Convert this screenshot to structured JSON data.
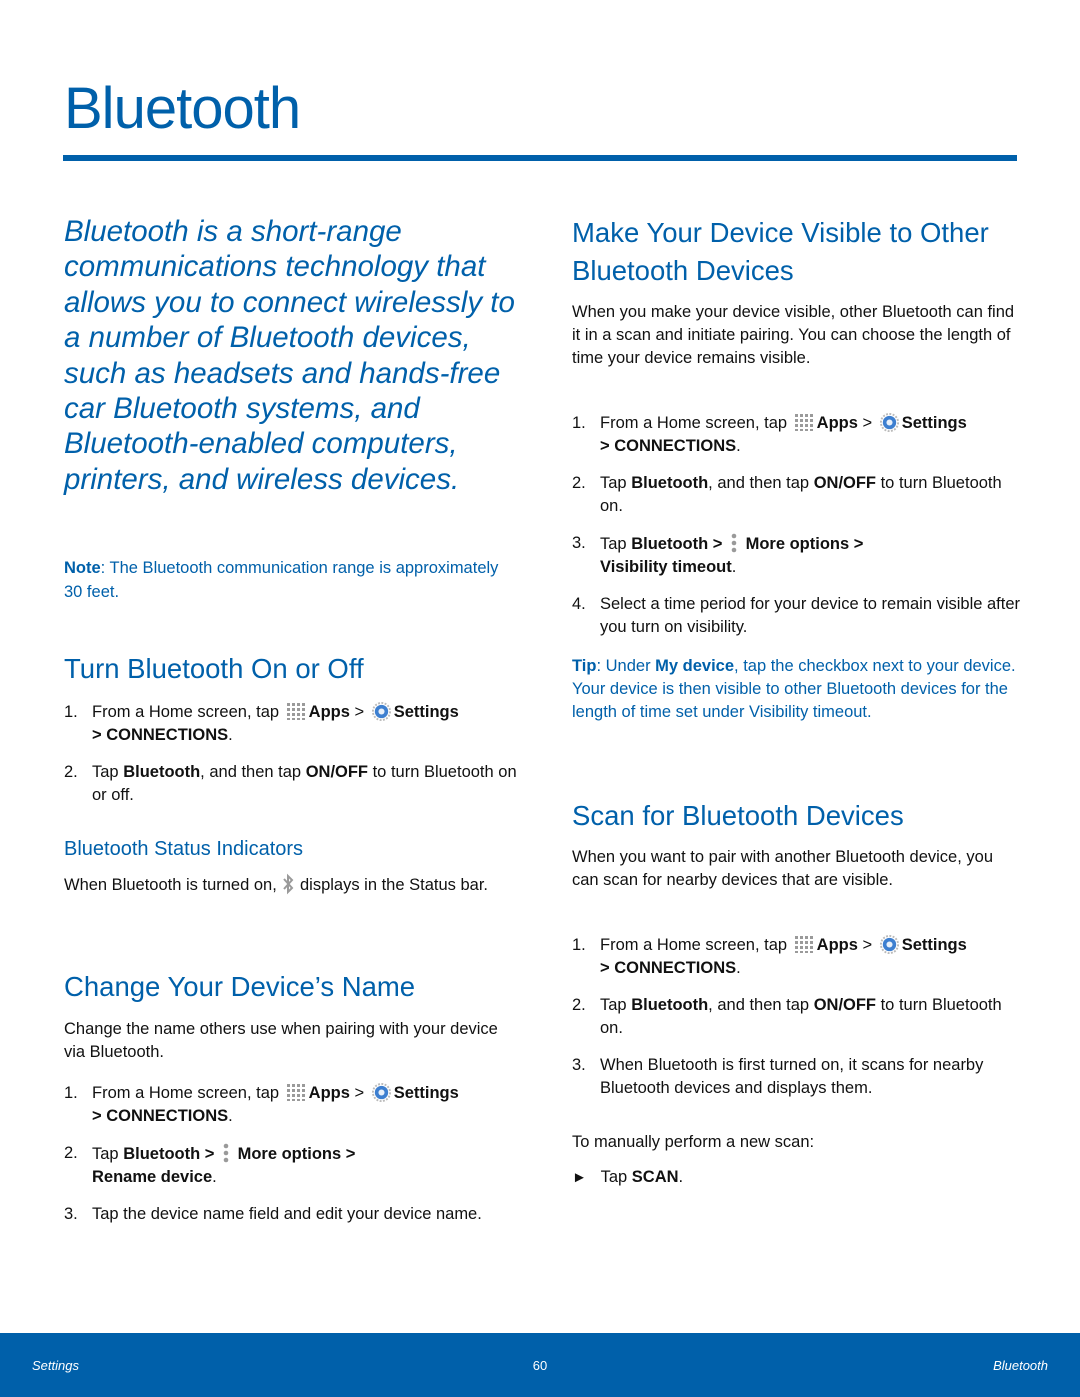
{
  "page": {
    "title": "Bluetooth"
  },
  "colors": {
    "accent": "#0060aa",
    "body_text": "#111111",
    "footer_bg": "#0060aa"
  },
  "left": {
    "intro": "Bluetooth is a short-range communications technology that allows you to connect wirelessly to a number of Bluetooth devices, such as headsets and hands-free car Bluetooth systems, and Bluetooth-enabled computers, printers, and wireless devices.",
    "note": {
      "label": "Note",
      "text": ": The Bluetooth communication range is approximately 30 feet."
    },
    "turn_on_off": {
      "heading": "Turn Bluetooth On or Off",
      "step1": {
        "num": "1.",
        "prefix": "From a Home screen, tap ",
        "apps": "Apps",
        "sep1": " > ",
        "settings": "Settings",
        "connections": "> CONNECTIONS",
        "end": "."
      },
      "step2": {
        "num": "2.",
        "t1": "Tap ",
        "b1": "Bluetooth",
        "t2": ", and then tap ",
        "b2": "ON/OFF",
        "t3": " to turn Bluetooth on or off."
      }
    },
    "status_indicators": {
      "heading": "Bluetooth Status Indicators",
      "text_before": "When Bluetooth is turned on, ",
      "text_after": " displays in the Status bar."
    },
    "change_name": {
      "heading": "Change Your Device’s Name",
      "intro": "Change the name others use when pairing with your device via Bluetooth.",
      "step1": {
        "num": "1.",
        "prefix": "From a Home screen, tap ",
        "apps": "Apps",
        "sep1": " > ",
        "settings": "Settings",
        "connections": "> CONNECTIONS",
        "end": "."
      },
      "step2": {
        "num": "2.",
        "t1": "Tap ",
        "b1": "Bluetooth >",
        "b2": "More options >",
        "b3": "Rename device",
        "end": "."
      },
      "step3": {
        "num": "3.",
        "text": "Tap the device name field and edit your device name."
      }
    }
  },
  "right": {
    "make_visible": {
      "heading": "Make Your Device Visible to Other Bluetooth Devices",
      "intro": "When you make your device visible, other Bluetooth can find it in a scan and initiate pairing. You can choose the length of time your device remains visible.",
      "step1": {
        "num": "1.",
        "prefix": "From a Home screen, tap ",
        "apps": "Apps",
        "sep1": " > ",
        "settings": "Settings",
        "connections": "> CONNECTIONS",
        "end": "."
      },
      "step2": {
        "num": "2.",
        "t1": "Tap ",
        "b1": "Bluetooth",
        "t2": ", and then tap ",
        "b2": "ON/OFF",
        "t3": " to turn Bluetooth on."
      },
      "step3": {
        "num": "3.",
        "t1": "Tap ",
        "b1": "Bluetooth >",
        "b2": "More options >",
        "b3": "Visibility timeout",
        "end": "."
      },
      "step4": {
        "num": "4.",
        "text": "Select a time period for your device to remain visible after you turn on visibility."
      },
      "tip": {
        "label": "Tip",
        "t1": ": Under ",
        "b1": "My device",
        "t2": ", tap the checkbox next to your device. Your device is then visible to other Bluetooth devices for the length of time set under Visibility timeout."
      }
    },
    "scan": {
      "heading": "Scan for Bluetooth Devices",
      "intro": "When you want to pair with another Bluetooth device, you can scan for nearby devices that are visible.",
      "step1": {
        "num": "1.",
        "prefix": "From a Home screen, tap ",
        "apps": "Apps",
        "sep1": " > ",
        "settings": "Settings",
        "connections": "> CONNECTIONS",
        "end": "."
      },
      "step2": {
        "num": "2.",
        "t1": "Tap ",
        "b1": "Bluetooth",
        "t2": ", and then tap ",
        "b2": "ON/OFF",
        "t3": " to turn Bluetooth on."
      },
      "step3": {
        "num": "3.",
        "text": "When Bluetooth is first turned on, it scans for nearby Bluetooth devices and displays them."
      },
      "manual": "To manually perform a new scan:",
      "bullet": {
        "t1": "Tap ",
        "b1": "SCAN",
        "end": "."
      }
    }
  },
  "footer": {
    "left": "Settings",
    "page_number": "60",
    "right": "Bluetooth"
  }
}
